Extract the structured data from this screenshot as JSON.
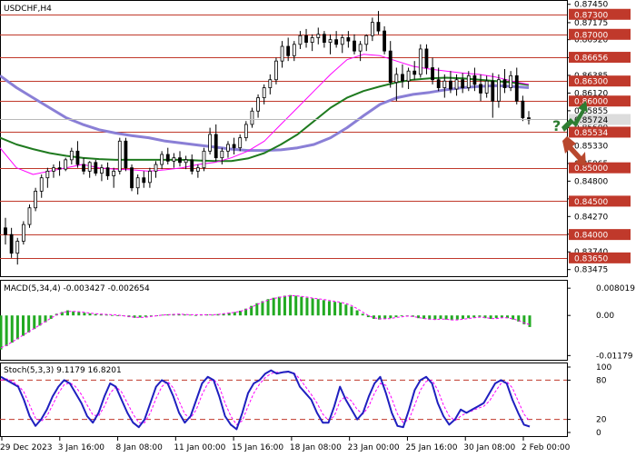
{
  "chart_data": [
    {
      "panel": "price",
      "type": "candlestick",
      "title": "USDCHF,H4",
      "ylim": [
        0.8343,
        0.8746
      ],
      "price_ticks": [
        "0.87450",
        "0.87175",
        "0.86920",
        "0.86650",
        "0.86385",
        "0.86120",
        "0.85855",
        "0.85600",
        "0.85330",
        "0.85065",
        "0.84800",
        "0.84535",
        "0.84270",
        "0.84005",
        "0.83740",
        "0.83475"
      ],
      "level_lines": [
        {
          "value": 0.873,
          "label": "0.87300"
        },
        {
          "value": 0.87,
          "label": "0.87000"
        },
        {
          "value": 0.86656,
          "label": "0.86656"
        },
        {
          "value": 0.863,
          "label": "0.86300"
        },
        {
          "value": 0.86,
          "label": "0.86000"
        },
        {
          "value": 0.85534,
          "label": "0.85534"
        },
        {
          "value": 0.85,
          "label": "0.85000"
        },
        {
          "value": 0.845,
          "label": "0.84500"
        },
        {
          "value": 0.84,
          "label": "0.84000"
        },
        {
          "value": 0.8365,
          "label": "0.83650"
        }
      ],
      "current_price": {
        "value": 0.85724,
        "label": "0.85724"
      },
      "line_colors": {
        "levels": "#c0392b",
        "label_bg": "#c0392b",
        "current_bg": "#dcdcdc",
        "candle": "#000000",
        "bull_fill": "#ffffff"
      },
      "ohlc": [
        [
          0.841,
          0.8425,
          0.8385,
          0.84
        ],
        [
          0.84,
          0.841,
          0.8365,
          0.8372
        ],
        [
          0.8372,
          0.8395,
          0.8355,
          0.839
        ],
        [
          0.839,
          0.842,
          0.8385,
          0.8415
        ],
        [
          0.8415,
          0.8445,
          0.841,
          0.844
        ],
        [
          0.844,
          0.847,
          0.8435,
          0.8465
        ],
        [
          0.8465,
          0.849,
          0.8455,
          0.8485
        ],
        [
          0.8485,
          0.85,
          0.847,
          0.8495
        ],
        [
          0.8495,
          0.8505,
          0.8485,
          0.85
        ],
        [
          0.85,
          0.851,
          0.8488,
          0.8498
        ],
        [
          0.8498,
          0.8515,
          0.8495,
          0.8512
        ],
        [
          0.8512,
          0.853,
          0.8505,
          0.8525
        ],
        [
          0.8525,
          0.854,
          0.85,
          0.8505
        ],
        [
          0.8505,
          0.8515,
          0.849,
          0.8495
        ],
        [
          0.8495,
          0.851,
          0.8485,
          0.8508
        ],
        [
          0.8508,
          0.8512,
          0.8488,
          0.8492
        ],
        [
          0.8492,
          0.8505,
          0.848,
          0.85
        ],
        [
          0.85,
          0.8508,
          0.8482,
          0.8488
        ],
        [
          0.8488,
          0.85,
          0.847,
          0.8495
        ],
        [
          0.8495,
          0.8545,
          0.849,
          0.854
        ],
        [
          0.854,
          0.8545,
          0.8495,
          0.85
        ],
        [
          0.85,
          0.8505,
          0.8465,
          0.847
        ],
        [
          0.847,
          0.849,
          0.846,
          0.8485
        ],
        [
          0.8485,
          0.8495,
          0.847,
          0.8478
        ],
        [
          0.8478,
          0.85,
          0.847,
          0.8495
        ],
        [
          0.8495,
          0.851,
          0.8485,
          0.8505
        ],
        [
          0.8505,
          0.8525,
          0.8498,
          0.852
        ],
        [
          0.852,
          0.853,
          0.8505,
          0.851
        ],
        [
          0.851,
          0.8522,
          0.85,
          0.8515
        ],
        [
          0.8515,
          0.8525,
          0.8502,
          0.8508
        ],
        [
          0.8508,
          0.8518,
          0.8498,
          0.8512
        ],
        [
          0.8512,
          0.852,
          0.849,
          0.8495
        ],
        [
          0.8495,
          0.8505,
          0.8485,
          0.85
        ],
        [
          0.85,
          0.853,
          0.8495,
          0.8525
        ],
        [
          0.8525,
          0.856,
          0.852,
          0.855
        ],
        [
          0.855,
          0.8565,
          0.851,
          0.8515
        ],
        [
          0.8515,
          0.853,
          0.8505,
          0.8525
        ],
        [
          0.8525,
          0.854,
          0.8515,
          0.8535
        ],
        [
          0.8535,
          0.8545,
          0.852,
          0.853
        ],
        [
          0.853,
          0.855,
          0.8525,
          0.8545
        ],
        [
          0.8545,
          0.857,
          0.854,
          0.8565
        ],
        [
          0.8565,
          0.859,
          0.856,
          0.8585
        ],
        [
          0.8585,
          0.861,
          0.8575,
          0.8605
        ],
        [
          0.8605,
          0.8625,
          0.8595,
          0.862
        ],
        [
          0.862,
          0.864,
          0.861,
          0.8632
        ],
        [
          0.8632,
          0.8665,
          0.8625,
          0.866
        ],
        [
          0.866,
          0.869,
          0.865,
          0.8682
        ],
        [
          0.8682,
          0.8695,
          0.866,
          0.8668
        ],
        [
          0.8668,
          0.869,
          0.866,
          0.8685
        ],
        [
          0.8685,
          0.8705,
          0.8678,
          0.8698
        ],
        [
          0.8698,
          0.8708,
          0.868,
          0.8688
        ],
        [
          0.8688,
          0.87,
          0.8675,
          0.8695
        ],
        [
          0.8695,
          0.871,
          0.8685,
          0.87
        ],
        [
          0.87,
          0.8705,
          0.868,
          0.8688
        ],
        [
          0.8688,
          0.87,
          0.867,
          0.8692
        ],
        [
          0.8692,
          0.8705,
          0.868,
          0.8685
        ],
        [
          0.8685,
          0.87,
          0.8672,
          0.8695
        ],
        [
          0.8695,
          0.8705,
          0.868,
          0.869
        ],
        [
          0.869,
          0.87,
          0.867,
          0.8675
        ],
        [
          0.8675,
          0.869,
          0.866,
          0.8685
        ],
        [
          0.8685,
          0.87,
          0.8675,
          0.8698
        ],
        [
          0.8698,
          0.8725,
          0.869,
          0.8718
        ],
        [
          0.8718,
          0.8735,
          0.87,
          0.8705
        ],
        [
          0.8705,
          0.8712,
          0.867,
          0.8675
        ],
        [
          0.8675,
          0.869,
          0.862,
          0.8628
        ],
        [
          0.8628,
          0.865,
          0.86,
          0.864
        ],
        [
          0.864,
          0.8655,
          0.862,
          0.863
        ],
        [
          0.863,
          0.865,
          0.8618,
          0.8645
        ],
        [
          0.8645,
          0.866,
          0.8632,
          0.864
        ],
        [
          0.864,
          0.8685,
          0.8635,
          0.8678
        ],
        [
          0.8678,
          0.8685,
          0.864,
          0.865
        ],
        [
          0.865,
          0.8665,
          0.8625,
          0.8632
        ],
        [
          0.8632,
          0.865,
          0.8615,
          0.862
        ],
        [
          0.862,
          0.864,
          0.8605,
          0.863
        ],
        [
          0.863,
          0.8645,
          0.8612,
          0.8618
        ],
        [
          0.8618,
          0.864,
          0.8608,
          0.8632
        ],
        [
          0.8632,
          0.8642,
          0.8612,
          0.862
        ],
        [
          0.862,
          0.8645,
          0.8615,
          0.8638
        ],
        [
          0.8638,
          0.865,
          0.8615,
          0.8625
        ],
        [
          0.8625,
          0.864,
          0.86,
          0.8612
        ],
        [
          0.8612,
          0.8638,
          0.8605,
          0.863
        ],
        [
          0.863,
          0.8642,
          0.8575,
          0.86
        ],
        [
          0.86,
          0.864,
          0.859,
          0.8632
        ],
        [
          0.8632,
          0.8648,
          0.8612,
          0.862
        ],
        [
          0.862,
          0.8645,
          0.8615,
          0.8638
        ],
        [
          0.8638,
          0.865,
          0.8595,
          0.86
        ],
        [
          0.86,
          0.8608,
          0.857,
          0.8575
        ],
        [
          0.8575,
          0.8585,
          0.8565,
          0.8572
        ]
      ],
      "moving_averages": [
        {
          "color": "#8a7fd6",
          "width": 3,
          "values": [
            0.8638,
            0.862,
            0.8605,
            0.859,
            0.8575,
            0.8565,
            0.8557,
            0.8552,
            0.8548,
            0.8545,
            0.854,
            0.8537,
            0.8534,
            0.8531,
            0.8528,
            0.8526,
            0.8526,
            0.8527,
            0.853,
            0.8535,
            0.8545,
            0.856,
            0.8578,
            0.8595,
            0.8605,
            0.861,
            0.8613,
            0.8617,
            0.862,
            0.8622,
            0.8623,
            0.8622,
            0.862
          ]
        },
        {
          "color": "#1f7a1f",
          "width": 2,
          "values": [
            0.8545,
            0.8535,
            0.8528,
            0.8522,
            0.8518,
            0.8515,
            0.8513,
            0.8512,
            0.8512,
            0.8512,
            0.8512,
            0.8512,
            0.8511,
            0.851,
            0.851,
            0.8514,
            0.8522,
            0.8535,
            0.855,
            0.857,
            0.859,
            0.8605,
            0.8615,
            0.8622,
            0.8628,
            0.8632,
            0.8634,
            0.8635,
            0.8634,
            0.8632,
            0.863,
            0.8628,
            0.8624
          ]
        },
        {
          "color": "#ff00ff",
          "width": 1,
          "values": [
            0.853,
            0.85,
            0.849,
            0.8495,
            0.85,
            0.8505,
            0.85,
            0.8498,
            0.8497,
            0.8495,
            0.8497,
            0.85,
            0.8505,
            0.8508,
            0.8515,
            0.8525,
            0.854,
            0.8565,
            0.859,
            0.8615,
            0.864,
            0.8662,
            0.867,
            0.8668,
            0.866,
            0.8652,
            0.8648,
            0.8645,
            0.8642,
            0.864,
            0.8636,
            0.863,
            0.8625
          ]
        }
      ],
      "time_labels": [
        "29 Dec 2023",
        "3 Jan 16:00",
        "8 Jan 08:00",
        "11 Jan 00:00",
        "15 Jan 16:00",
        "18 Jan 08:00",
        "23 Jan 00:00",
        "25 Jan 16:00",
        "30 Jan 08:00",
        "2 Feb 00:00"
      ],
      "annotations": {
        "question_mark": "?",
        "arrow_up_color": "#2e7d32",
        "arrow_down_color": "#c0392b"
      }
    },
    {
      "panel": "macd",
      "type": "bar",
      "title": "MACD(5,34,4) -0.003427 -0.002654",
      "ylim": [
        -0.0125,
        0.0094
      ],
      "ticks": [
        "0.008019",
        "0.00",
        "-0.01179"
      ],
      "bar_color": "#22aa22",
      "signal_color": "#ff00ff",
      "values": [
        -0.01,
        -0.009,
        -0.008,
        -0.007,
        -0.006,
        -0.005,
        -0.004,
        -0.003,
        -0.002,
        -0.001,
        0.0005,
        0.001,
        0.0015,
        0.0012,
        0.001,
        0.0008,
        0.0006,
        0.0004,
        0.0003,
        0.0002,
        0.0001,
        0.0,
        -0.0002,
        -0.0005,
        -0.0007,
        -0.0006,
        -0.0004,
        -0.0002,
        0.0,
        0.0002,
        0.0003,
        0.0004,
        0.0004,
        0.0003,
        0.0002,
        0.0001,
        0.0002,
        0.0003,
        0.0002,
        0.0004,
        0.0006,
        0.0008,
        0.001,
        0.0014,
        0.002,
        0.0028,
        0.0036,
        0.0042,
        0.0048,
        0.0052,
        0.0055,
        0.0058,
        0.006,
        0.0058,
        0.0055,
        0.0052,
        0.005,
        0.0048,
        0.0045,
        0.0042,
        0.004,
        0.0038,
        0.0032,
        0.0026,
        0.0015,
        0.0005,
        -0.0005,
        -0.001,
        -0.0012,
        -0.001,
        -0.0008,
        -0.0005,
        -0.0002,
        -0.0001,
        -0.0004,
        -0.0008,
        -0.001,
        -0.0012,
        -0.0012,
        -0.001,
        -0.0012,
        -0.0014,
        -0.0012,
        -0.001,
        -0.0008,
        -0.0006,
        -0.0004,
        -0.0008,
        -0.001,
        -0.0008,
        -0.0006,
        -0.0008,
        -0.0012,
        -0.0018,
        -0.0026,
        -0.0034
      ],
      "signal": [
        -0.0095,
        -0.0088,
        -0.0078,
        -0.0068,
        -0.0058,
        -0.0048,
        -0.0038,
        -0.0028,
        -0.0018,
        -0.0008,
        0.0002,
        0.0008,
        0.0012,
        0.0012,
        0.0011,
        0.0009,
        0.0007,
        0.0005,
        0.0004,
        0.0003,
        0.0002,
        0.0001,
        -0.0001,
        -0.0003,
        -0.0005,
        -0.0006,
        -0.0005,
        -0.0003,
        -0.0001,
        0.0001,
        0.0002,
        0.0003,
        0.0004,
        0.0003,
        0.0002,
        0.0002,
        0.0002,
        0.0002,
        0.0002,
        0.0003,
        0.0005,
        0.0007,
        0.0009,
        0.0012,
        0.0017,
        0.0024,
        0.0032,
        0.0039,
        0.0045,
        0.005,
        0.0053,
        0.0056,
        0.0058,
        0.0058,
        0.0056,
        0.0054,
        0.0051,
        0.0049,
        0.0047,
        0.0044,
        0.0041,
        0.0039,
        0.0035,
        0.0029,
        0.002,
        0.001,
        0.0,
        -0.0007,
        -0.001,
        -0.001,
        -0.0009,
        -0.0006,
        -0.0004,
        -0.0002,
        -0.0003,
        -0.0006,
        -0.0009,
        -0.0011,
        -0.0012,
        -0.0011,
        -0.0011,
        -0.0013,
        -0.0013,
        -0.0011,
        -0.0009,
        -0.0007,
        -0.0005,
        -0.0006,
        -0.0009,
        -0.0009,
        -0.0007,
        -0.0007,
        -0.001,
        -0.0015,
        -0.0022,
        -0.0027
      ]
    },
    {
      "panel": "stochastic",
      "type": "line",
      "title": "Stoch(5,3,3) 9.1179 16.8201",
      "ylim": [
        0,
        100
      ],
      "ticks": [
        "100",
        "80",
        "20",
        "0"
      ],
      "levels": [
        80,
        20
      ],
      "level_color": "#c0392b",
      "main_color": "#1f1fbf",
      "signal_color": "#ff00ff",
      "main": [
        85,
        80,
        75,
        70,
        50,
        25,
        10,
        20,
        35,
        55,
        70,
        80,
        75,
        60,
        45,
        25,
        15,
        30,
        55,
        75,
        70,
        50,
        30,
        15,
        8,
        20,
        45,
        70,
        80,
        75,
        55,
        30,
        15,
        25,
        50,
        75,
        85,
        80,
        55,
        25,
        12,
        5,
        30,
        60,
        75,
        80,
        90,
        95,
        90,
        92,
        93,
        90,
        70,
        60,
        50,
        30,
        15,
        15,
        40,
        70,
        50,
        35,
        20,
        30,
        55,
        75,
        85,
        60,
        30,
        10,
        8,
        35,
        65,
        80,
        85,
        75,
        45,
        25,
        12,
        20,
        35,
        30,
        35,
        40,
        45,
        60,
        75,
        80,
        75,
        50,
        30,
        12,
        9
      ],
      "signal": [
        80,
        82,
        78,
        72,
        62,
        42,
        22,
        17,
        25,
        42,
        60,
        73,
        76,
        70,
        58,
        42,
        27,
        25,
        40,
        60,
        70,
        62,
        45,
        28,
        15,
        15,
        30,
        52,
        70,
        78,
        68,
        48,
        28,
        22,
        35,
        58,
        75,
        82,
        70,
        45,
        25,
        12,
        18,
        40,
        60,
        74,
        84,
        90,
        92,
        92,
        92,
        91,
        82,
        70,
        58,
        45,
        28,
        18,
        25,
        48,
        55,
        48,
        35,
        28,
        40,
        60,
        75,
        72,
        52,
        28,
        15,
        20,
        42,
        65,
        78,
        80,
        65,
        42,
        25,
        18,
        25,
        30,
        33,
        37,
        40,
        48,
        62,
        75,
        78,
        68,
        48,
        28,
        17
      ]
    }
  ]
}
